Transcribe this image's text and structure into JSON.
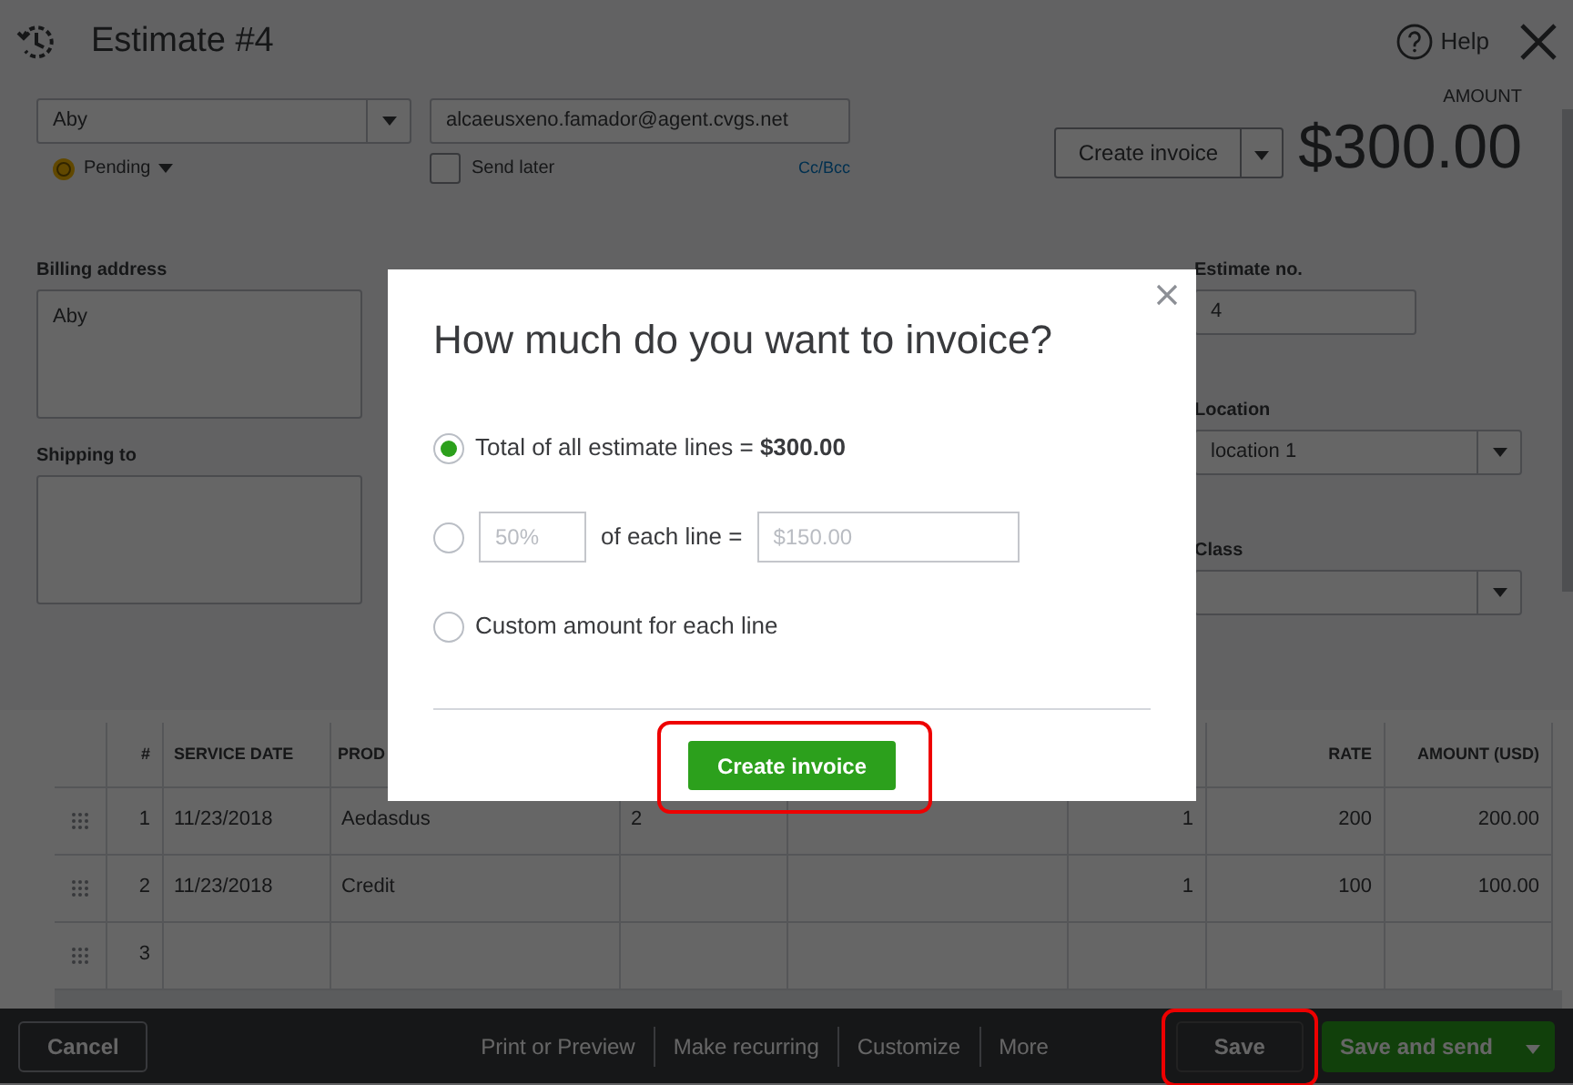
{
  "header": {
    "title": "Estimate #4",
    "help": "Help"
  },
  "customer": {
    "value": "Aby"
  },
  "email": {
    "value": "alcaeusxeno.famador@agent.cvgs.net"
  },
  "status": {
    "label": "Pending"
  },
  "send_later": {
    "label": "Send later",
    "checked": false
  },
  "cc_bcc": "Cc/Bcc",
  "action_button": {
    "label": "Create invoice"
  },
  "amount": {
    "label": "AMOUNT",
    "value": "$300.00"
  },
  "billing_address": {
    "label": "Billing address",
    "value": "Aby"
  },
  "shipping_to": {
    "label": "Shipping to"
  },
  "estimate_no": {
    "label": "Estimate no.",
    "value": "4"
  },
  "location": {
    "label": "Location",
    "value": "location 1"
  },
  "class_field": {
    "label": "Class"
  },
  "table": {
    "columns": {
      "number": "#",
      "service_date": "SERVICE DATE",
      "column_3": "PROD",
      "rate": "RATE",
      "amount": "AMOUNT (USD)"
    },
    "rows": [
      {
        "number": "1",
        "service_date": "11/23/2018",
        "column_3": "Aedasdus",
        "column_4": "2",
        "column_6": "1",
        "rate": "200",
        "amount": "200.00"
      },
      {
        "number": "2",
        "service_date": "11/23/2018",
        "column_3": "Credit",
        "column_6": "1",
        "rate": "100",
        "amount": "100.00"
      },
      {
        "number": "3"
      }
    ]
  },
  "footer": {
    "cancel": "Cancel",
    "links": [
      "Print or Preview",
      "Make recurring",
      "Customize",
      "More"
    ],
    "save": {
      "label": "Save",
      "highlighted": true
    },
    "save_and_send": "Save and send"
  },
  "dialog": {
    "title": "How much do you want to invoice?",
    "options": [
      {
        "kind": "total",
        "label": "Total of all estimate lines = **$300.00**",
        "selected": true
      },
      {
        "kind": "percent",
        "percent_placeholder": "50%",
        "label": "of each line =",
        "amount_placeholder": "$150.00",
        "selected": false
      },
      {
        "kind": "plain",
        "label": "Custom amount for each line",
        "selected": false
      }
    ],
    "button": {
      "label": "Create invoice",
      "highlighted": true
    }
  }
}
